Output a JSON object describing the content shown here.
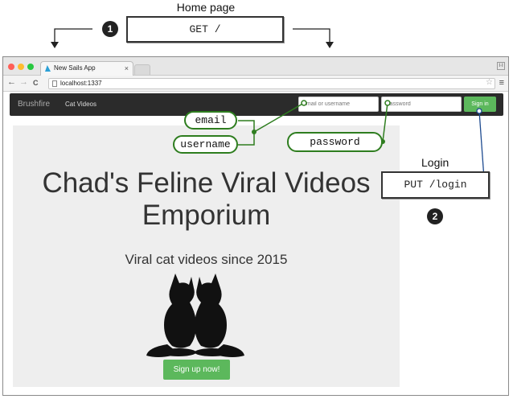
{
  "annotations": {
    "home_title": "Home page",
    "home_request": "GET /",
    "login_title": "Login",
    "login_request": "PUT /login",
    "step1": "1",
    "step2": "2",
    "callout_email": "email",
    "callout_username": "username",
    "callout_password": "password"
  },
  "browser": {
    "tab_title": "New Sails App",
    "tab_close": "×",
    "url": "localhost:1337",
    "nav_back": "←",
    "nav_forward": "→",
    "nav_reload": "C",
    "menu_glyph": "≡",
    "star_glyph": "☆",
    "profile_glyph": "I·I"
  },
  "app": {
    "brand": "Brushfire",
    "nav_link": "Cat Videos",
    "email_placeholder": "email or username",
    "password_placeholder": "Password",
    "signin_label": "Sign in",
    "hero_title": "Chad's Feline Viral Videos Emporium",
    "hero_subtitle": "Viral cat videos since 2015",
    "signup_label": "Sign up now!"
  },
  "colors": {
    "navbar": "#2b2b2b",
    "accent_green": "#5cb85c",
    "callout_green": "#2e7d1f",
    "hero_bg": "#eeeeee",
    "link_blue": "#1d4a8f"
  },
  "icons": [
    "back-arrow-icon",
    "forward-arrow-icon",
    "reload-icon",
    "page-icon",
    "star-icon",
    "menu-icon",
    "sails-favicon-icon",
    "cat-silhouettes-icon"
  ]
}
